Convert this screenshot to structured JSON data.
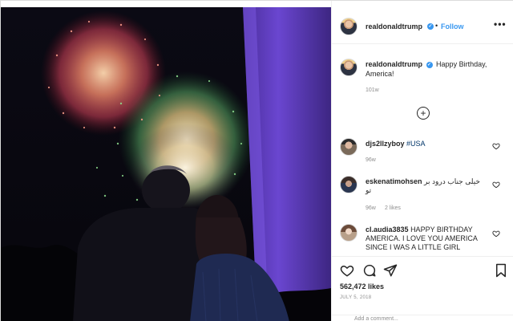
{
  "post": {
    "author": "realdonaldtrump",
    "follow_label": "Follow",
    "more_label": "•••",
    "verified_glyph": "✓",
    "caption": "Happy Birthday, America!",
    "caption_time": "101w",
    "load_more_label": "+"
  },
  "comments": [
    {
      "user": "djs2llzyboy",
      "text": "#USA",
      "time": "96w",
      "likes": ""
    },
    {
      "user": "eskenatimohsen",
      "text": "خیلی جناب درود بر تو",
      "time": "96w",
      "likes": "2 likes"
    },
    {
      "user": "cl.audia3835",
      "text": "HAPPY BIRTHDAY AMERICA. I LOVE YOU AMERICA SINCE I WAS A LITTLE GIRL",
      "time": "",
      "likes": ""
    }
  ],
  "stats": {
    "likes": "562,472 likes",
    "date": "JULY 5, 2018"
  },
  "add_comment": {
    "placeholder": "Add a comment..."
  },
  "icons": {
    "heart": "heart-icon",
    "comment": "comment-icon",
    "share": "share-icon",
    "save": "bookmark-icon",
    "verified": "verified-badge-icon"
  },
  "colors": {
    "link_blue": "#3897f0",
    "muted": "#8e8e8e",
    "text": "#262626",
    "monument_purple": "#5a3ac0"
  }
}
